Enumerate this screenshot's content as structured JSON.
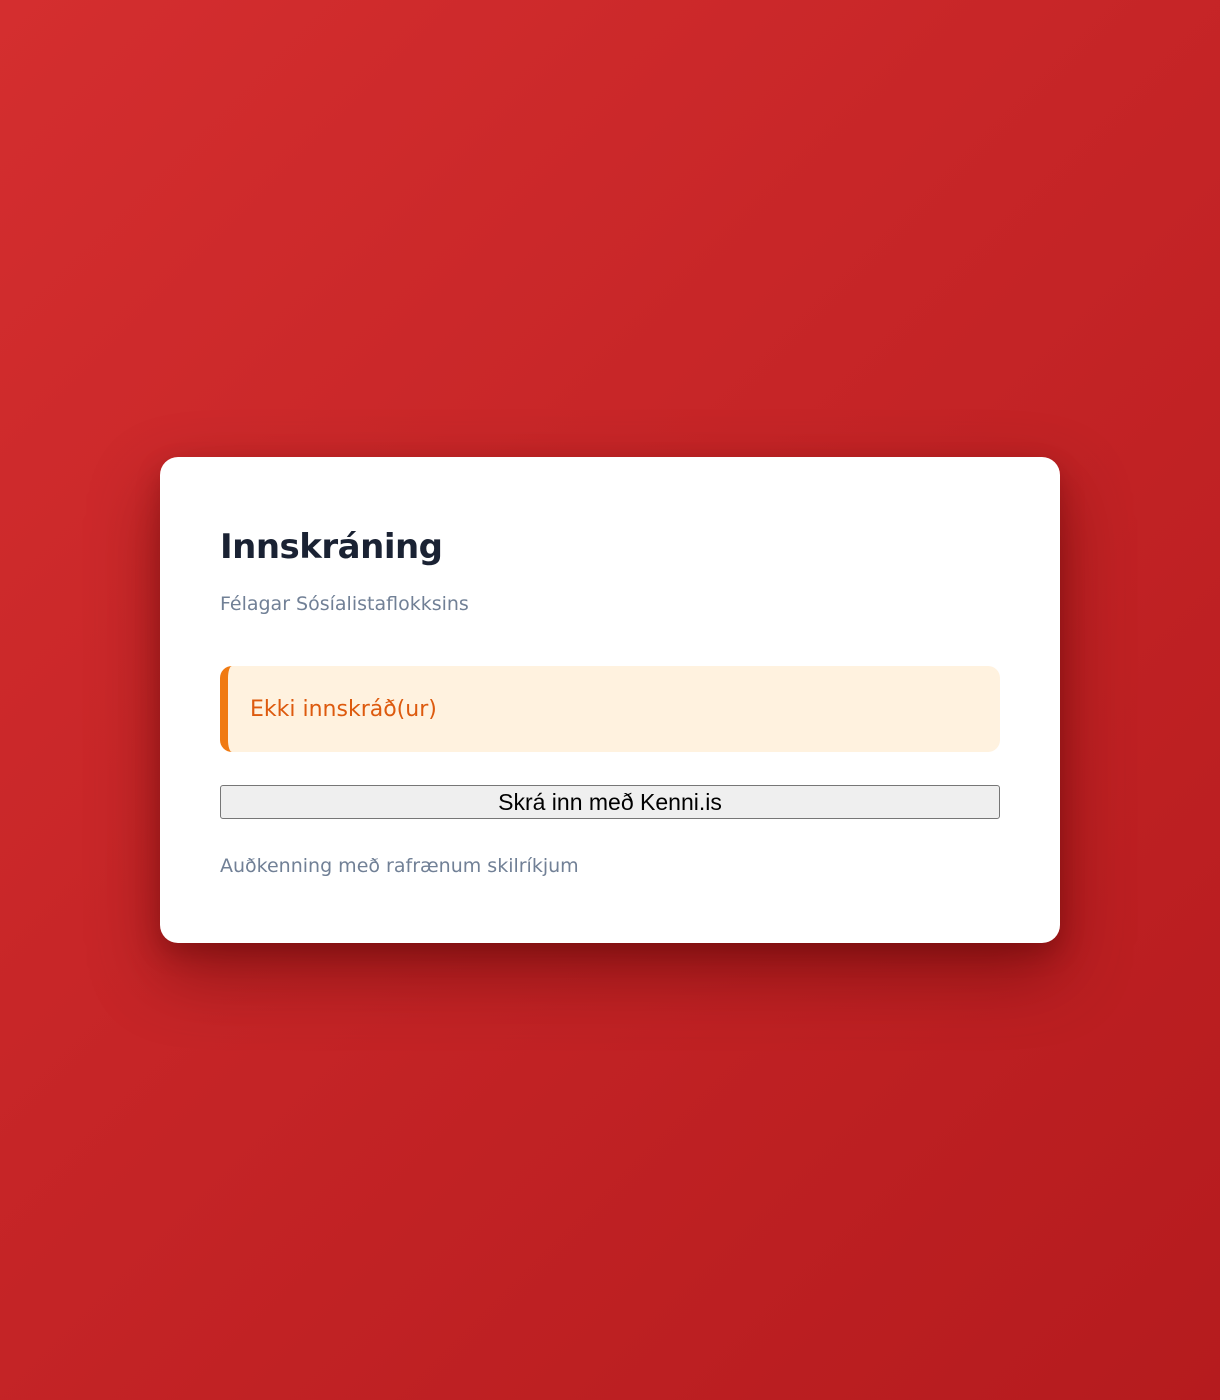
{
  "login": {
    "title": "Innskráning",
    "subtitle": "Félagar Sósíalistaflokksins",
    "status_message": "Ekki innskráð(ur)",
    "login_button_label": "Skrá inn með Kenni.is",
    "footnote": "Auðkenning með rafrænum skilríkjum"
  },
  "colors": {
    "background_top": "#d42e2f",
    "background_bottom": "#b51b1e",
    "card_background": "#ffffff",
    "title_text": "#1a2233",
    "muted_text": "#718096",
    "alert_background": "#fff2df",
    "alert_accent": "#f07a12",
    "alert_text": "#dd5a0e"
  }
}
